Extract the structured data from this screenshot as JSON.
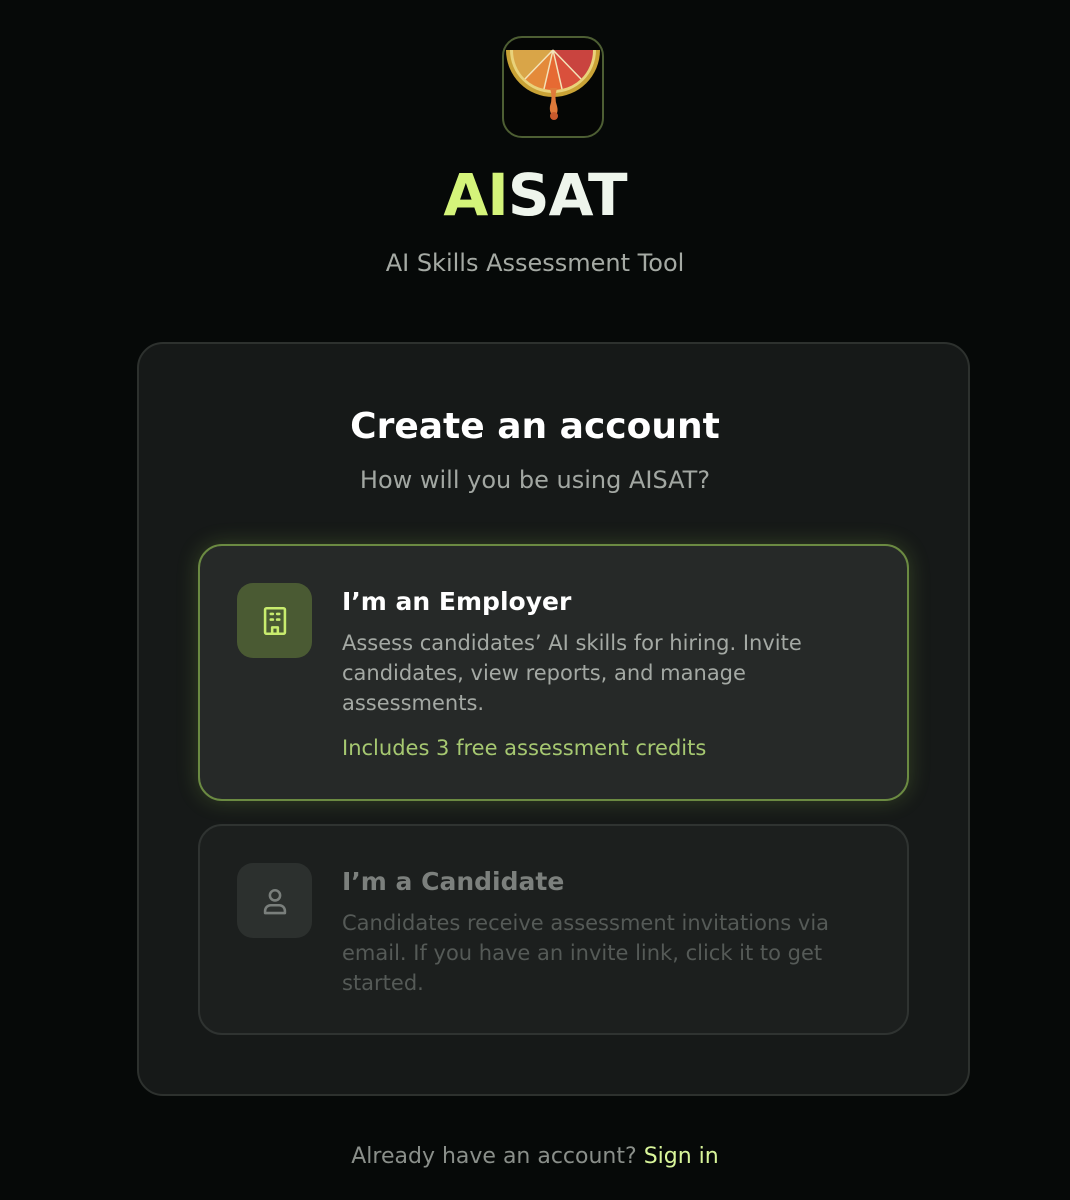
{
  "brand": {
    "accent": "AI",
    "rest": "SAT",
    "tagline": "AI Skills Assessment Tool",
    "logo": "citrus-slice-logo"
  },
  "card": {
    "title": "Create an account",
    "subtitle": "How will you be using AISAT?"
  },
  "options": [
    {
      "id": "employer",
      "icon": "building-icon",
      "title": "I’m an Employer",
      "description": "Assess candidates’ AI skills for hiring. Invite candidates, view reports, and manage assessments.",
      "note": "Includes 3 free assessment credits",
      "selected": true
    },
    {
      "id": "candidate",
      "icon": "user-icon",
      "title": "I’m a Candidate",
      "description": "Candidates receive assessment invitations via email. If you have an invite link, click it to get started.",
      "selected": false
    }
  ],
  "footer": {
    "prompt": "Already have an account?",
    "link": "Sign in"
  },
  "colors": {
    "background": "#060908",
    "accent": "#d4f47a",
    "card": "#161918",
    "selected_border": "#6b8a42",
    "note": "#a6c871"
  }
}
